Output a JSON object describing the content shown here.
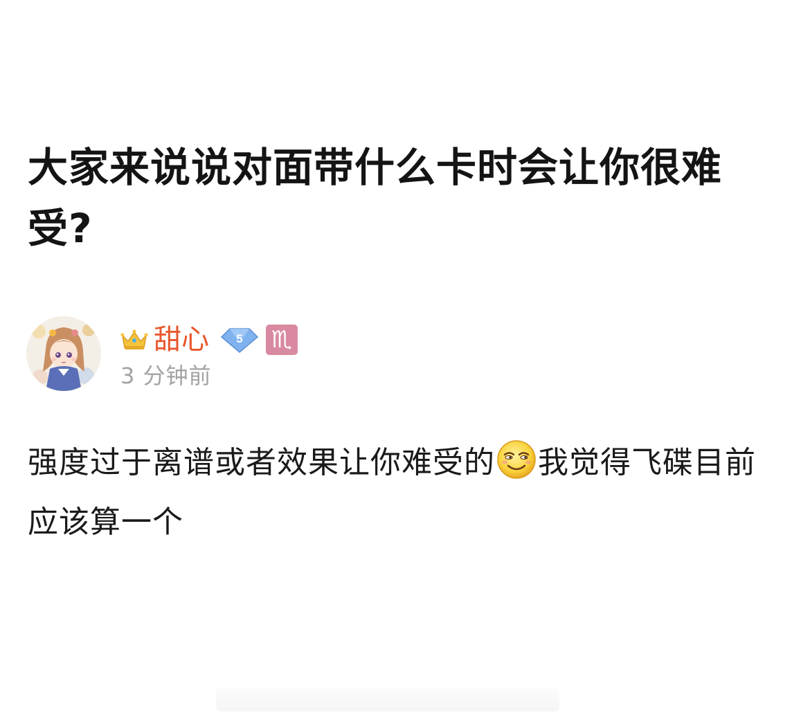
{
  "post": {
    "title": "大家来说说对面带什么卡时会让你很难受?",
    "body_before_emoji": "强度过于离谱或者效果让你难受的",
    "emoji_icon": "grinning-smirk-emoji",
    "body_after_emoji": "我觉得飞碟目前应该算一个"
  },
  "author": {
    "name": "甜心",
    "name_color": "#e8572d",
    "vip_icon": "crown-icon",
    "level": "5",
    "level_badge_color": "#6fa4e8",
    "zodiac_symbol": "♏",
    "zodiac_badge_color": "#d98aa1",
    "avatar_icon": "anime-girl-avatar",
    "timestamp": "3 分钟前"
  }
}
